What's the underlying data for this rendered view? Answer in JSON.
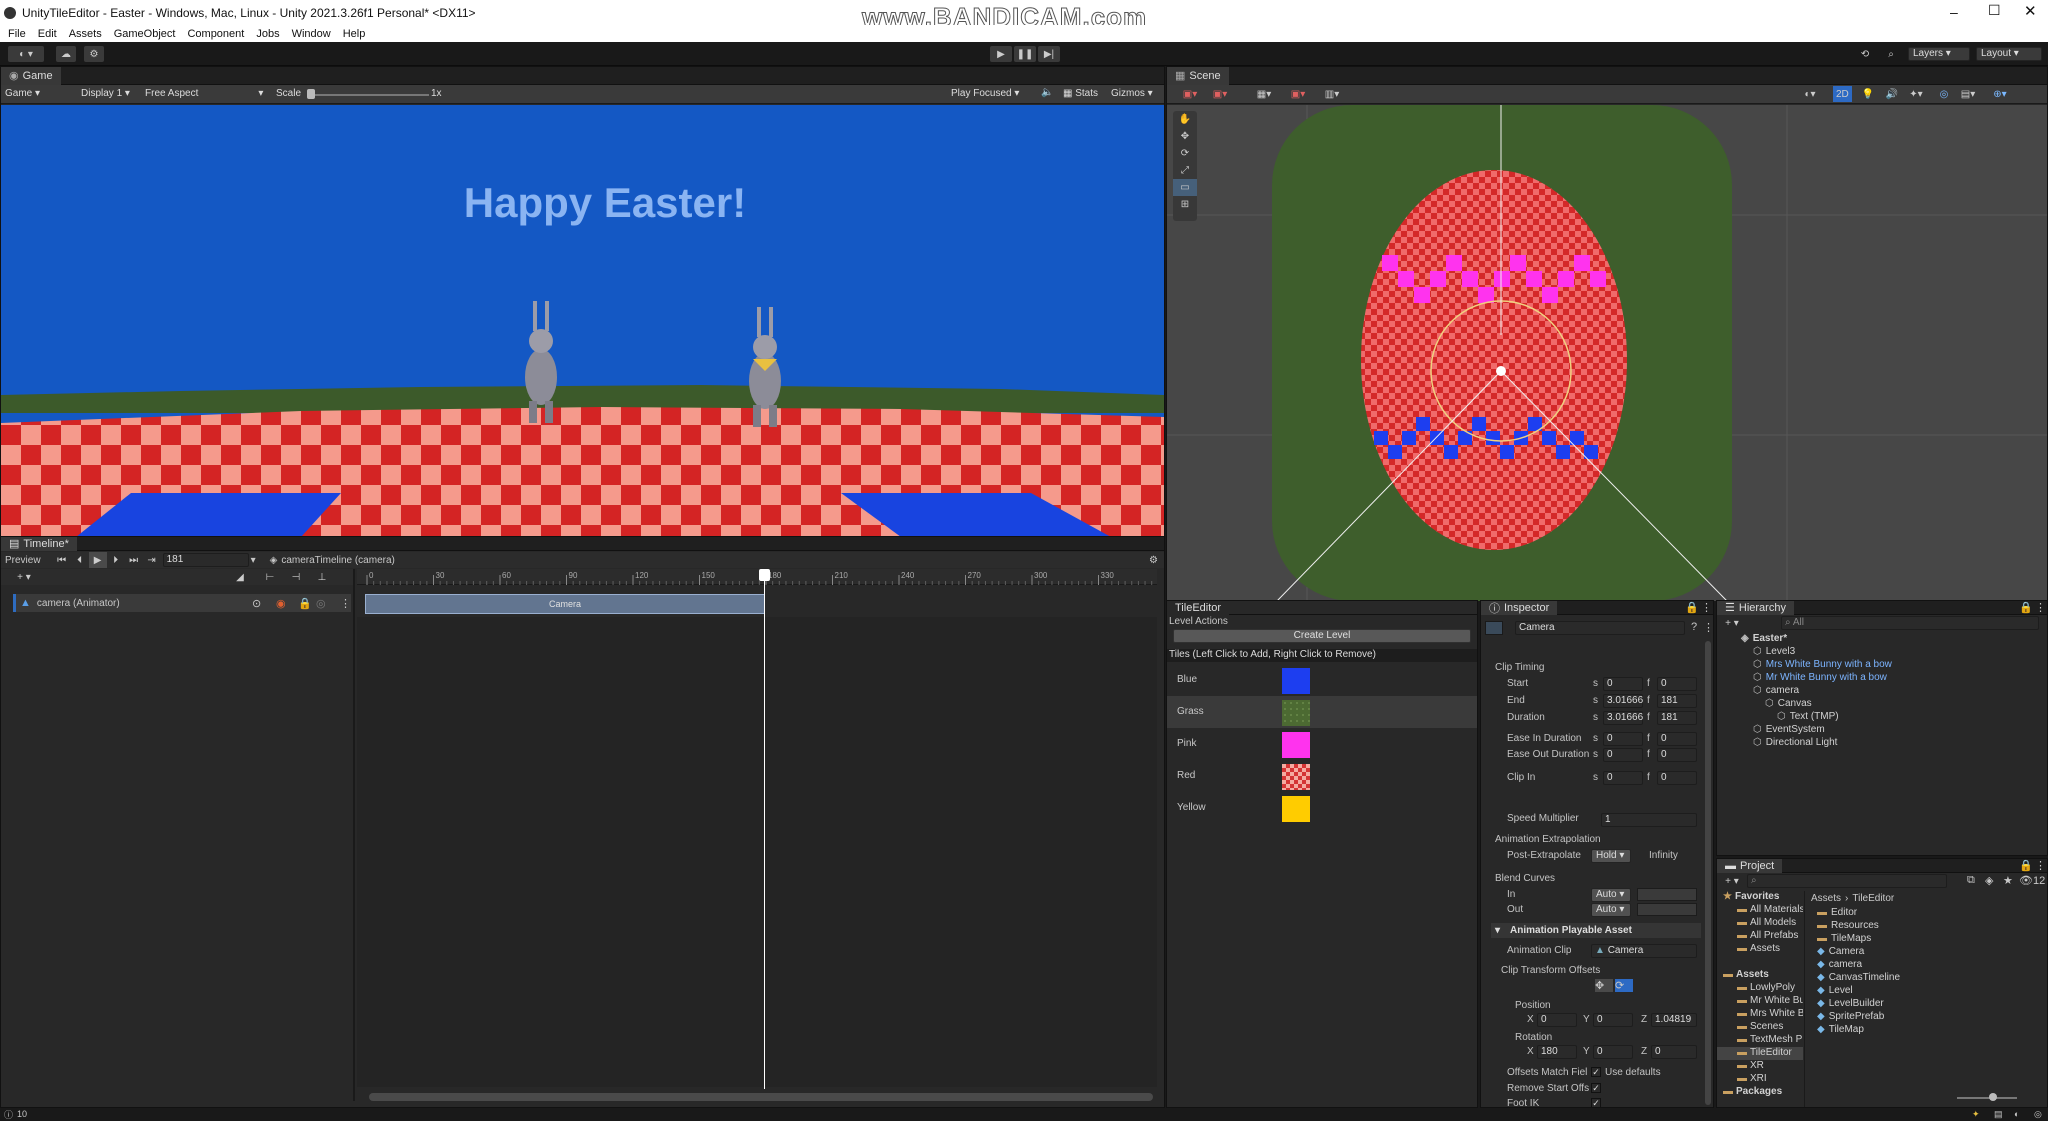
{
  "window": {
    "title": "UnityTileEditor - Easter - Windows, Mac, Linux - Unity 2021.3.26f1 Personal* <DX11>",
    "watermark": "www.BANDICAM.com"
  },
  "menu": [
    "File",
    "Edit",
    "Assets",
    "GameObject",
    "Component",
    "Jobs",
    "Window",
    "Help"
  ],
  "game": {
    "tab": "Game",
    "display_dd": "Game",
    "display": "Display 1",
    "aspect": "Free Aspect",
    "scale_label": "Scale",
    "scale_value": "1x",
    "play_focused": "Play Focused",
    "stats": "Stats",
    "gizmos": "Gizmos",
    "banner": "Happy Easter!",
    "colors": {
      "sky": "#1458c4",
      "banner": "#8ab4f2",
      "checker_a": "#d42424",
      "checker_b": "#f59a8c",
      "blue_tile": "#1844e0"
    }
  },
  "scene": {
    "tab": "Scene",
    "mode_2d": "2D"
  },
  "top_right": {
    "layers": "Layers",
    "layout": "Layout"
  },
  "timeline": {
    "tab": "Timeline*",
    "preview": "Preview",
    "frame": "181",
    "asset": "cameraTimeline (camera)",
    "track": "camera (Animator)",
    "clip": "Camera",
    "ticks": [
      "0",
      "30",
      "60",
      "90",
      "120",
      "150",
      "180",
      "210",
      "240",
      "270",
      "300",
      "330"
    ]
  },
  "tileeditor": {
    "tab": "TileEditor",
    "level_actions": "Level Actions",
    "create_level": "Create Level",
    "tiles_header": "Tiles (Left Click to Add, Right Click to Remove)",
    "tiles": [
      {
        "name": "Blue",
        "color": "#1d3ef0"
      },
      {
        "name": "Grass",
        "color": "#4c6a32"
      },
      {
        "name": "Pink",
        "color": "#ff33ee"
      },
      {
        "name": "Red",
        "color": "#d43434"
      },
      {
        "name": "Yellow",
        "color": "#ffcc00"
      }
    ]
  },
  "inspector": {
    "tab": "Inspector",
    "object": "Camera",
    "clip_timing": "Clip Timing",
    "rows": [
      {
        "label": "Start",
        "s": "0",
        "f": "0"
      },
      {
        "label": "End",
        "s": "3.01666",
        "f": "181"
      },
      {
        "label": "Duration",
        "s": "3.01666",
        "f": "181"
      },
      {
        "label": "Ease In Duration",
        "s": "0",
        "f": "0"
      },
      {
        "label": "Ease Out Duration",
        "s": "0",
        "f": "0"
      },
      {
        "label": "Clip In",
        "s": "0",
        "f": "0"
      }
    ],
    "s_label": "s",
    "f_label": "f",
    "speed_label": "Speed Multiplier",
    "speed_value": "1",
    "anim_extrap": "Animation Extrapolation",
    "post_label": "Post-Extrapolate",
    "post_value": "Hold",
    "post_extra": "Infinity",
    "blend_curves": "Blend Curves",
    "in_label": "In",
    "in_value": "Auto",
    "out_label": "Out",
    "out_value": "Auto",
    "asset_header": "Animation Playable Asset",
    "anim_clip_label": "Animation Clip",
    "anim_clip_value": "Camera",
    "cto": "Clip Transform Offsets",
    "position_label": "Position",
    "position": {
      "x": "0",
      "y": "0",
      "z": "1.04819"
    },
    "rotation_label": "Rotation",
    "rotation": {
      "x": "180",
      "y": "0",
      "z": "0"
    },
    "offsets_match": "Offsets Match Fiel",
    "use_defaults": "Use defaults",
    "remove_start": "Remove Start Offs",
    "foot_ik": "Foot IK"
  },
  "hierarchy": {
    "tab": "Hierarchy",
    "search": "All",
    "items": [
      {
        "label": "Easter*",
        "indent": 0
      },
      {
        "label": "Level3",
        "indent": 1
      },
      {
        "label": "Mrs White Bunny with a bow",
        "indent": 1
      },
      {
        "label": "Mr White Bunny with a bow",
        "indent": 1
      },
      {
        "label": "camera",
        "indent": 1
      },
      {
        "label": "Canvas",
        "indent": 2
      },
      {
        "label": "Text (TMP)",
        "indent": 3
      },
      {
        "label": "EventSystem",
        "indent": 1
      },
      {
        "label": "Directional Light",
        "indent": 1
      }
    ]
  },
  "project": {
    "tab": "Project",
    "count": "12",
    "breadcrumb_root": "Assets",
    "breadcrumb_leaf": "TileEditor",
    "left": [
      {
        "label": "Favorites",
        "indent": 0
      },
      {
        "label": "All Materials",
        "indent": 1
      },
      {
        "label": "All Models",
        "indent": 1
      },
      {
        "label": "All Prefabs",
        "indent": 1
      },
      {
        "label": "Assets",
        "indent": 1
      },
      {
        "label": "",
        "indent": 0
      },
      {
        "label": "Assets",
        "indent": 0
      },
      {
        "label": "LowlyPoly",
        "indent": 1
      },
      {
        "label": "Mr White Bu",
        "indent": 1
      },
      {
        "label": "Mrs White B",
        "indent": 1
      },
      {
        "label": "Scenes",
        "indent": 1
      },
      {
        "label": "TextMesh P",
        "indent": 1
      },
      {
        "label": "TileEditor",
        "indent": 1
      },
      {
        "label": "XR",
        "indent": 1
      },
      {
        "label": "XRI",
        "indent": 1
      },
      {
        "label": "Packages",
        "indent": 0
      }
    ],
    "right": [
      "Editor",
      "Resources",
      "TileMaps",
      "Camera",
      "camera",
      "CanvasTimeline",
      "Level",
      "LevelBuilder",
      "SpritePrefab",
      "TileMap"
    ]
  },
  "status": {
    "left": "10"
  }
}
